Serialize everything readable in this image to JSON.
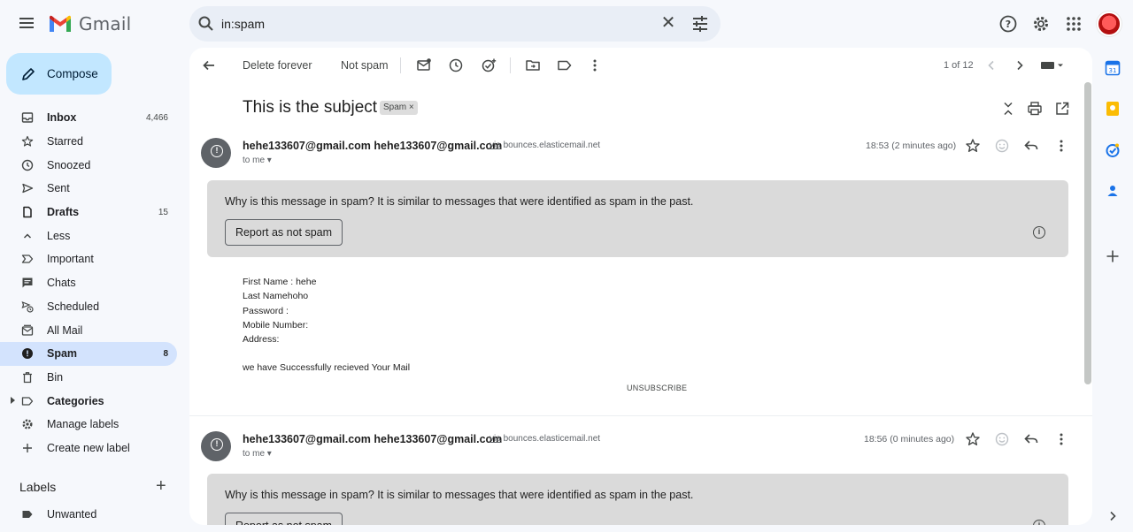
{
  "header": {
    "app_name": "Gmail",
    "search_value": "in:spam"
  },
  "compose": {
    "label": "Compose"
  },
  "nav": [
    {
      "key": "inbox",
      "label": "Inbox",
      "count": "4,466",
      "bold": true
    },
    {
      "key": "starred",
      "label": "Starred",
      "count": ""
    },
    {
      "key": "snoozed",
      "label": "Snoozed",
      "count": ""
    },
    {
      "key": "sent",
      "label": "Sent",
      "count": ""
    },
    {
      "key": "drafts",
      "label": "Drafts",
      "count": "15",
      "bold": true
    },
    {
      "key": "less",
      "label": "Less",
      "count": ""
    },
    {
      "key": "important",
      "label": "Important",
      "count": ""
    },
    {
      "key": "chats",
      "label": "Chats",
      "count": ""
    },
    {
      "key": "scheduled",
      "label": "Scheduled",
      "count": ""
    },
    {
      "key": "allmail",
      "label": "All Mail",
      "count": ""
    },
    {
      "key": "spam",
      "label": "Spam",
      "count": "8",
      "bold": true,
      "active": true
    },
    {
      "key": "bin",
      "label": "Bin",
      "count": ""
    },
    {
      "key": "categories",
      "label": "Categories",
      "count": "",
      "bold": true
    },
    {
      "key": "manage",
      "label": "Manage labels",
      "count": ""
    },
    {
      "key": "create",
      "label": "Create new label",
      "count": ""
    }
  ],
  "labels": {
    "title": "Labels",
    "items": [
      "Unwanted"
    ]
  },
  "toolbar": {
    "delete_forever": "Delete forever",
    "not_spam": "Not spam",
    "pager": "1 of 12"
  },
  "thread": {
    "subject": "This is the subject",
    "spam_chip": "Spam ×",
    "messages": [
      {
        "from_name": "hehe133607@gmail.com",
        "from_email": "hehe133607@gmail.com",
        "via_word": "via",
        "via_domain": "bounces.elasticemail.net",
        "to": "to me",
        "time": "18:53 (2 minutes ago)",
        "warning_q": "Why is this message in spam?",
        "warning_text": " It is similar to messages that were identified as spam in the past.",
        "report_button": "Report as not spam",
        "body": [
          "First Name : hehe",
          "Last Namehoho",
          "Password :",
          "Mobile Number:",
          "Address:",
          "",
          "we have Successfully recieved Your Mail"
        ],
        "unsubscribe": "UNSUBSCRIBE"
      },
      {
        "from_name": "hehe133607@gmail.com",
        "from_email": "hehe133607@gmail.com",
        "via_word": "via",
        "via_domain": "bounces.elasticemail.net",
        "to": "to me",
        "time": "18:56 (0 minutes ago)",
        "warning_q": "Why is this message in spam?",
        "warning_text": " It is similar to messages that were identified as spam in the past.",
        "report_button": "Report as not spam"
      }
    ]
  },
  "colors": {
    "accent": "#c2e7ff",
    "active_nav": "#d3e3fd",
    "warning_bg": "#dadada",
    "page_bg": "#f6f8fc"
  }
}
